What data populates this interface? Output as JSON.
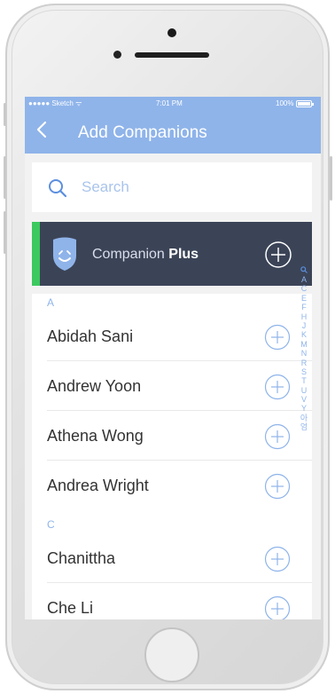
{
  "status_bar": {
    "carrier": "●●●●● Sketch ᯤ",
    "time": "7:01 PM",
    "battery": "100%"
  },
  "header": {
    "back_icon": "chevron-left-icon",
    "title": "Add Companions",
    "background": "#8fb4ea"
  },
  "search": {
    "placeholder": "Search",
    "value": ""
  },
  "companion_plus": {
    "label_prefix": "Companion ",
    "label_bold": "Plus",
    "accent_color": "#3cc95f",
    "background": "#3b4457"
  },
  "sections": [
    {
      "letter": "A",
      "contacts": [
        "Abidah Sani",
        "Andrew Yoon",
        "Athena Wong",
        "Andrea Wright"
      ]
    },
    {
      "letter": "C",
      "contacts": [
        "Chanittha",
        "Che Li"
      ]
    }
  ],
  "index": [
    "A",
    "C",
    "E",
    "F",
    "H",
    "J",
    "K",
    "M",
    "N",
    "R",
    "S",
    "T",
    "U",
    "V",
    "Y",
    "아",
    "엄"
  ]
}
